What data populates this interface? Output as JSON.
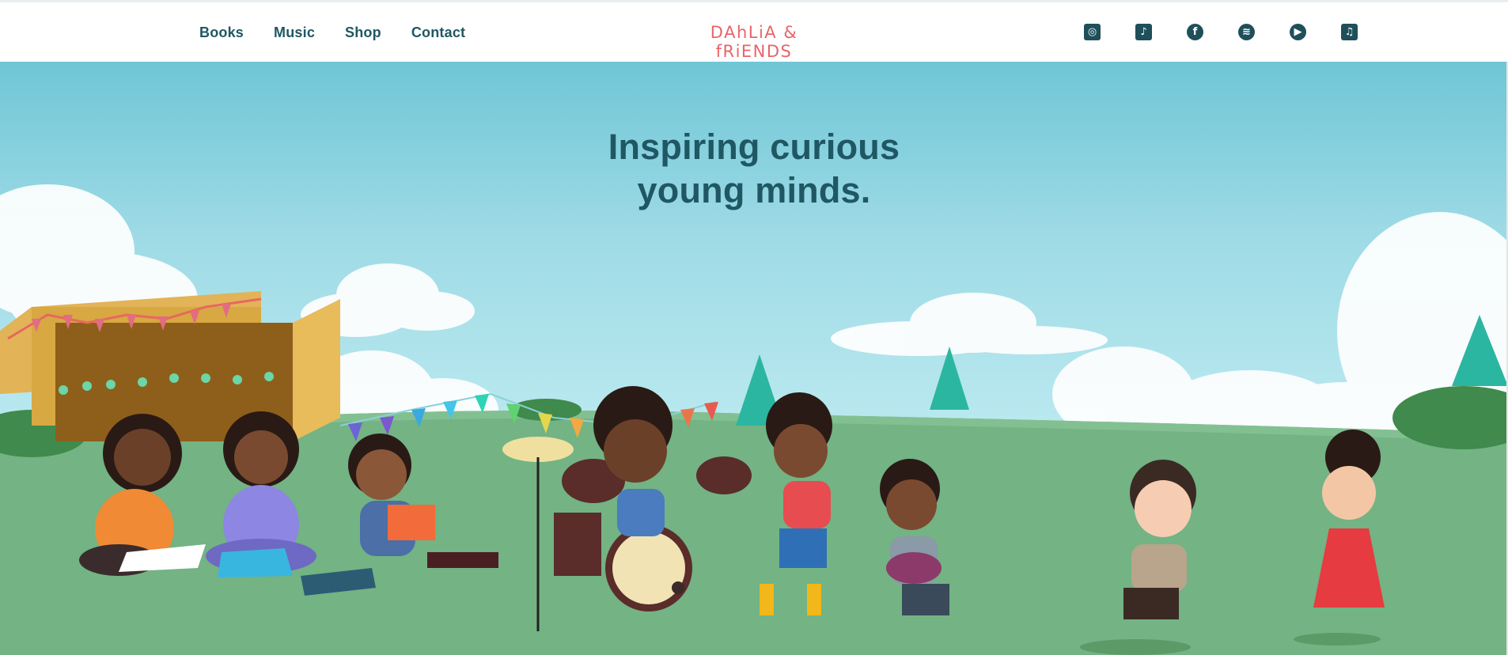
{
  "nav": {
    "items": [
      {
        "label": "Books"
      },
      {
        "label": "Music"
      },
      {
        "label": "Shop"
      },
      {
        "label": "Contact"
      }
    ]
  },
  "brand": {
    "logo_text": "DAhLiA & fRiENDS"
  },
  "socials": [
    {
      "name": "instagram-icon",
      "glyph": "◎"
    },
    {
      "name": "tiktok-icon",
      "glyph": "♪"
    },
    {
      "name": "facebook-icon",
      "glyph": "f"
    },
    {
      "name": "spotify-icon",
      "glyph": "≋"
    },
    {
      "name": "youtube-icon",
      "glyph": "▶"
    },
    {
      "name": "apple-music-icon",
      "glyph": "♫"
    }
  ],
  "hero": {
    "headline_line1": "Inspiring curious",
    "headline_line2": "young minds."
  },
  "colors": {
    "brand_teal": "#1f5763",
    "logo_coral": "#e8656a",
    "sky_top": "#6fc6d6",
    "sky_bottom": "#c7edf2",
    "grass": "#73b384"
  }
}
